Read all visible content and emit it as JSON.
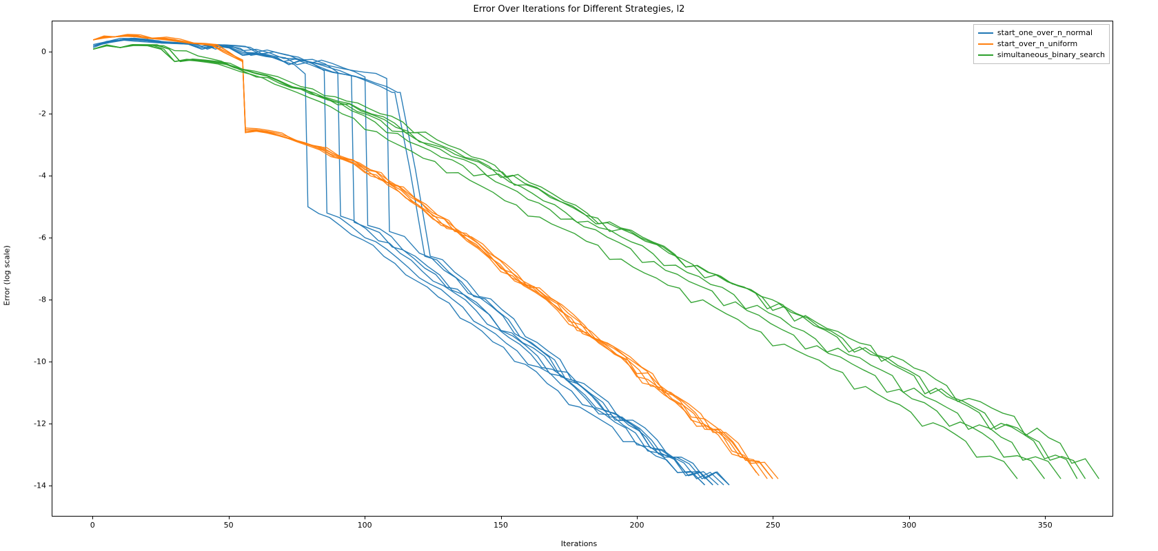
{
  "chart_data": {
    "type": "line",
    "title": "Error Over Iterations for Different Strategies, l2",
    "xlabel": "Iterations",
    "ylabel": "Error (log scale)",
    "xlim": [
      -15,
      375
    ],
    "ylim": [
      -15,
      1
    ],
    "xticks": [
      0,
      50,
      100,
      150,
      200,
      250,
      300,
      350
    ],
    "yticks": [
      0,
      -2,
      -4,
      -6,
      -8,
      -10,
      -12,
      -14
    ],
    "legend_position": "upper right",
    "series": [
      {
        "name": "start_one_over_n_normal",
        "color": "#1f77b4",
        "note": "multiple runs plotted with same color",
        "runs": [
          {
            "x": [
              0,
              10,
              25,
              40,
              55,
              70,
              78,
              79,
              95,
              115,
              135,
              155,
              175,
              195,
              215,
              225
            ],
            "y": [
              0.2,
              0.4,
              0.3,
              0.15,
              0.0,
              -0.3,
              -0.7,
              -5.0,
              -5.9,
              -7.2,
              -8.6,
              -10.0,
              -11.4,
              -12.6,
              -13.6,
              -14.0
            ]
          },
          {
            "x": [
              0,
              10,
              25,
              40,
              55,
              70,
              85,
              86,
              100,
              120,
              140,
              160,
              180,
              200,
              215,
              225
            ],
            "y": [
              0.25,
              0.45,
              0.35,
              0.2,
              0.05,
              -0.2,
              -0.6,
              -5.2,
              -6.0,
              -7.3,
              -8.7,
              -10.1,
              -11.4,
              -12.7,
              -13.6,
              -14.0
            ]
          },
          {
            "x": [
              0,
              12,
              28,
              44,
              60,
              76,
              90,
              91,
              105,
              125,
              145,
              165,
              185,
              205,
              218,
              228
            ],
            "y": [
              0.2,
              0.4,
              0.3,
              0.15,
              0.0,
              -0.25,
              -0.65,
              -5.3,
              -6.1,
              -7.4,
              -8.8,
              -10.2,
              -11.5,
              -12.8,
              -13.6,
              -14.0
            ]
          },
          {
            "x": [
              0,
              10,
              25,
              40,
              55,
              70,
              95,
              96,
              110,
              130,
              150,
              170,
              188,
              205,
              218,
              228
            ],
            "y": [
              0.2,
              0.4,
              0.3,
              0.1,
              -0.05,
              -0.3,
              -0.75,
              -5.5,
              -6.3,
              -7.6,
              -9.0,
              -10.3,
              -11.6,
              -12.8,
              -13.7,
              -14.0
            ]
          },
          {
            "x": [
              0,
              12,
              28,
              45,
              62,
              80,
              100,
              101,
              114,
              132,
              150,
              168,
              186,
              204,
              219,
              230
            ],
            "y": [
              0.2,
              0.4,
              0.3,
              0.1,
              -0.05,
              -0.35,
              -0.8,
              -5.6,
              -6.4,
              -7.7,
              -9.0,
              -10.4,
              -11.7,
              -12.9,
              -13.7,
              -14.0
            ]
          },
          {
            "x": [
              0,
              10,
              25,
              40,
              55,
              72,
              108,
              109,
              120,
              138,
              155,
              172,
              190,
              208,
              222,
              232
            ],
            "y": [
              0.2,
              0.4,
              0.3,
              0.1,
              -0.1,
              -0.4,
              -0.85,
              -5.8,
              -6.5,
              -7.8,
              -9.1,
              -10.5,
              -11.8,
              -13.0,
              -13.8,
              -14.0
            ]
          },
          {
            "x": [
              0,
              10,
              26,
              42,
              58,
              75,
              110,
              111,
              122,
              140,
              157,
              174,
              192,
              210,
              224,
              234
            ],
            "y": [
              0.15,
              0.4,
              0.3,
              0.1,
              -0.1,
              -0.4,
              -1.3,
              -1.3,
              -6.6,
              -7.9,
              -9.2,
              -10.6,
              -11.9,
              -13.1,
              -13.8,
              -14.0
            ]
          },
          {
            "x": [
              0,
              10,
              25,
              40,
              55,
              72,
              112,
              113,
              124,
              142,
              159,
              176,
              194,
              212,
              225,
              234
            ],
            "y": [
              0.2,
              0.4,
              0.3,
              0.1,
              -0.1,
              -0.4,
              -1.3,
              -1.3,
              -6.6,
              -7.9,
              -9.2,
              -10.6,
              -11.9,
              -13.1,
              -13.8,
              -14.0
            ]
          }
        ]
      },
      {
        "name": "start_over_n_uniform",
        "color": "#ff7f0e",
        "note": "multiple runs plotted with same color",
        "runs": [
          {
            "x": [
              0,
              8,
              20,
              35,
              48,
              55,
              56,
              75,
              100,
              125,
              150,
              175,
              200,
              220,
              235,
              245
            ],
            "y": [
              0.4,
              0.5,
              0.45,
              0.3,
              0.0,
              -0.3,
              -2.5,
              -2.9,
              -3.9,
              -5.4,
              -7.1,
              -8.8,
              -10.5,
              -11.9,
              -13.0,
              -13.7
            ]
          },
          {
            "x": [
              0,
              8,
              22,
              37,
              50,
              55,
              56,
              78,
              105,
              130,
              155,
              180,
              205,
              225,
              240,
              250
            ],
            "y": [
              0.4,
              0.5,
              0.45,
              0.3,
              0.0,
              -0.3,
              -2.55,
              -2.95,
              -4.1,
              -5.7,
              -7.4,
              -9.1,
              -10.8,
              -12.2,
              -13.2,
              -13.8
            ]
          },
          {
            "x": [
              0,
              8,
              20,
              35,
              48,
              55,
              56,
              76,
              102,
              128,
              154,
              178,
              202,
              222,
              238,
              248
            ],
            "y": [
              0.4,
              0.5,
              0.45,
              0.3,
              0.05,
              -0.25,
              -2.5,
              -2.9,
              -4.0,
              -5.6,
              -7.3,
              -9.0,
              -10.7,
              -12.1,
              -13.1,
              -13.8
            ]
          },
          {
            "x": [
              0,
              8,
              20,
              35,
              48,
              55,
              56,
              80,
              108,
              133,
              158,
              183,
              208,
              226,
              240,
              250
            ],
            "y": [
              0.4,
              0.5,
              0.45,
              0.3,
              0.0,
              -0.3,
              -2.6,
              -3.0,
              -4.2,
              -5.8,
              -7.5,
              -9.2,
              -10.9,
              -12.2,
              -13.2,
              -13.8
            ]
          },
          {
            "x": [
              0,
              8,
              20,
              35,
              48,
              55,
              56,
              74,
              100,
              125,
              150,
              175,
              200,
              220,
              235,
              244
            ],
            "y": [
              0.4,
              0.5,
              0.45,
              0.3,
              0.05,
              -0.25,
              -2.45,
              -2.85,
              -3.8,
              -5.3,
              -7.0,
              -8.7,
              -10.4,
              -11.8,
              -12.9,
              -13.6
            ]
          },
          {
            "x": [
              0,
              8,
              22,
              37,
              50,
              55,
              56,
              82,
              110,
              135,
              160,
              185,
              210,
              228,
              242,
              252
            ],
            "y": [
              0.4,
              0.5,
              0.45,
              0.3,
              0.0,
              -0.3,
              -2.6,
              -3.05,
              -4.3,
              -5.9,
              -7.6,
              -9.3,
              -11.0,
              -12.3,
              -13.3,
              -13.8
            ]
          }
        ]
      },
      {
        "name": "simultaneous_binary_search",
        "color": "#2ca02c",
        "note": "multiple runs plotted with same color",
        "runs": [
          {
            "x": [
              0,
              10,
              25,
              30,
              50,
              75,
              100,
              130,
              160,
              190,
              220,
              250,
              280,
              305,
              325,
              340
            ],
            "y": [
              0.1,
              0.15,
              0.1,
              -0.3,
              -0.5,
              -1.3,
              -2.5,
              -3.9,
              -5.3,
              -6.7,
              -8.1,
              -9.5,
              -10.9,
              -12.1,
              -13.1,
              -13.8
            ]
          },
          {
            "x": [
              0,
              10,
              28,
              32,
              55,
              82,
              108,
              140,
              172,
              202,
              232,
              262,
              292,
              315,
              335,
              350
            ],
            "y": [
              0.1,
              0.15,
              0.1,
              -0.3,
              -0.55,
              -1.4,
              -2.6,
              -4.0,
              -5.4,
              -6.8,
              -8.2,
              -9.6,
              -11.0,
              -12.1,
              -13.1,
              -13.8
            ]
          },
          {
            "x": [
              0,
              10,
              26,
              30,
              52,
              80,
              110,
              145,
              178,
              210,
              240,
              270,
              298,
              322,
              342,
              356
            ],
            "y": [
              0.1,
              0.15,
              0.1,
              -0.3,
              -0.5,
              -1.35,
              -2.55,
              -4.0,
              -5.5,
              -6.9,
              -8.3,
              -9.7,
              -11.0,
              -12.2,
              -13.2,
              -13.8
            ]
          },
          {
            "x": [
              0,
              10,
              25,
              30,
              52,
              82,
              115,
              150,
              185,
              218,
              250,
              280,
              308,
              332,
              352,
              365
            ],
            "y": [
              0.1,
              0.15,
              0.1,
              -0.3,
              -0.5,
              -1.4,
              -2.6,
              -4.05,
              -5.55,
              -6.95,
              -8.35,
              -9.7,
              -11.05,
              -12.2,
              -13.2,
              -13.8
            ]
          },
          {
            "x": [
              0,
              10,
              30,
              60,
              90,
              120,
              155,
              190,
              225,
              258,
              290,
              318,
              343,
              360,
              370
            ],
            "y": [
              0.1,
              0.15,
              0.05,
              -0.8,
              -1.7,
              -2.9,
              -4.3,
              -5.8,
              -7.3,
              -8.7,
              -10.0,
              -11.3,
              -12.4,
              -13.3,
              -13.8
            ]
          },
          {
            "x": [
              0,
              10,
              28,
              32,
              55,
              85,
              118,
              152,
              186,
              218,
              248,
              278,
              306,
              330,
              350,
              362
            ],
            "y": [
              0.1,
              0.15,
              0.1,
              -0.3,
              -0.55,
              -1.4,
              -2.6,
              -4.05,
              -5.55,
              -6.95,
              -8.3,
              -9.7,
              -11.05,
              -12.2,
              -13.15,
              -13.8
            ]
          }
        ]
      }
    ]
  }
}
